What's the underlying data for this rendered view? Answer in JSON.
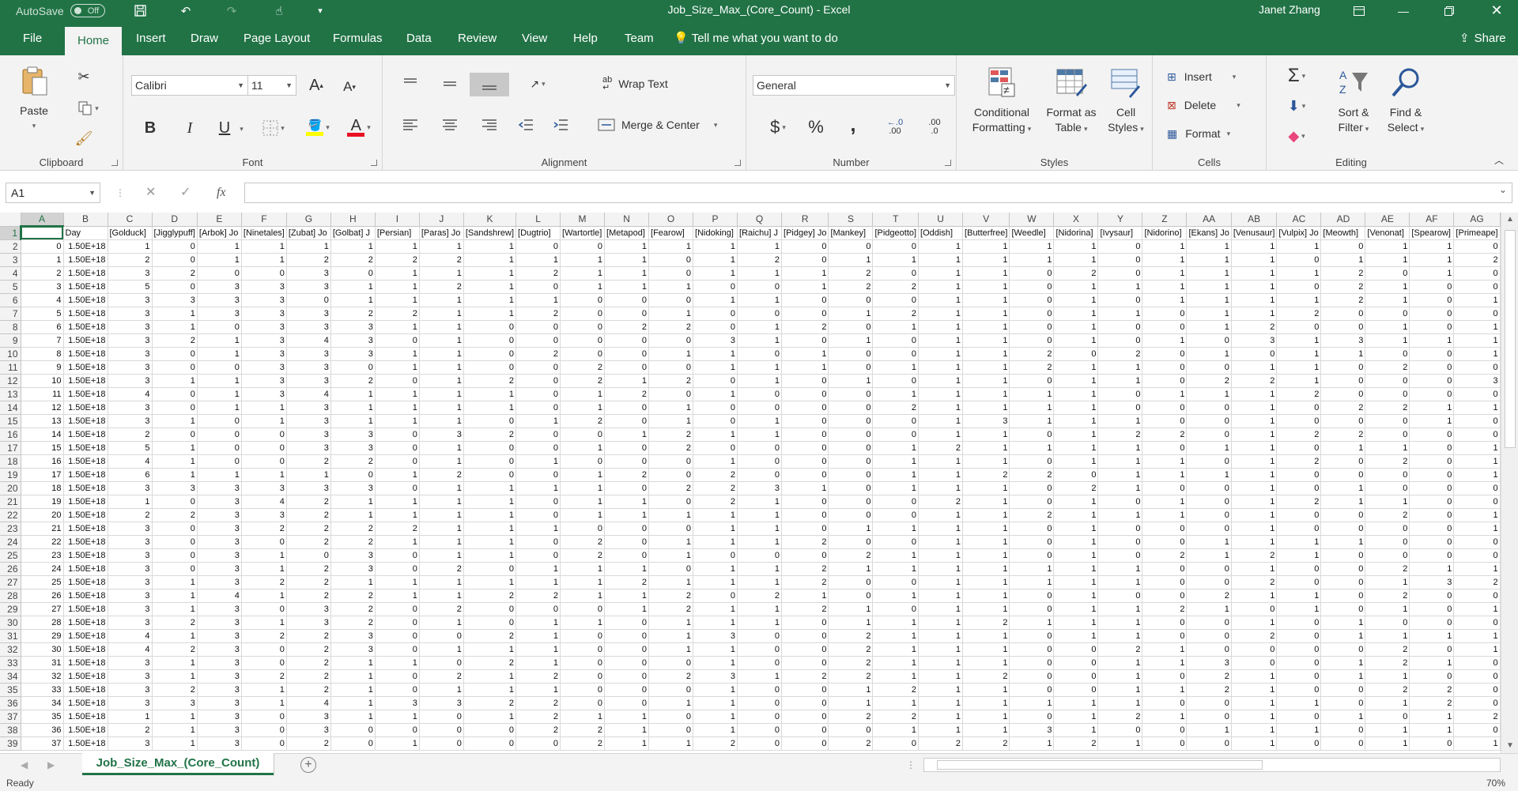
{
  "app": {
    "title": "Job_Size_Max_(Core_Count)  -  Excel",
    "autosave_label": "AutoSave",
    "autosave_state": "Off",
    "user": "Janet Zhang",
    "accent": "#217346"
  },
  "tabs": [
    "File",
    "Home",
    "Insert",
    "Draw",
    "Page Layout",
    "Formulas",
    "Data",
    "Review",
    "View",
    "Help",
    "Team"
  ],
  "tell_me": "Tell me what you want to do",
  "share": "Share",
  "ribbon": {
    "clipboard": {
      "label": "Clipboard",
      "paste": "Paste"
    },
    "font": {
      "label": "Font",
      "name": "Calibri",
      "size": "11",
      "bold": "B",
      "italic": "I",
      "underline": "U"
    },
    "alignment": {
      "label": "Alignment",
      "wrap": "Wrap Text",
      "merge": "Merge & Center"
    },
    "number": {
      "label": "Number",
      "format": "General",
      "currency": "$",
      "percent": "%",
      "comma": ",",
      "inc_decimal": ".00",
      "dec_decimal": ".0"
    },
    "styles": {
      "label": "Styles",
      "conditional": [
        "Conditional",
        "Formatting"
      ],
      "format_table": [
        "Format as",
        "Table"
      ],
      "cell_styles": [
        "Cell",
        "Styles"
      ]
    },
    "cells": {
      "label": "Cells",
      "insert": "Insert",
      "delete": "Delete",
      "format": "Format"
    },
    "editing": {
      "label": "Editing",
      "sort": [
        "Sort &",
        "Filter"
      ],
      "find": [
        "Find &",
        "Select"
      ]
    }
  },
  "formula_bar": {
    "name_box": "A1",
    "fx": "fx",
    "content": ""
  },
  "grid": {
    "columns": [
      "A",
      "B",
      "C",
      "D",
      "E",
      "F",
      "G",
      "H",
      "I",
      "J",
      "K",
      "L",
      "M",
      "N",
      "O",
      "P",
      "Q",
      "R",
      "S",
      "T",
      "U",
      "V",
      "W",
      "X",
      "Y",
      "Z",
      "AA",
      "AB",
      "AC",
      "AD",
      "AE",
      "AF",
      "AG"
    ],
    "header_row": [
      "",
      "Day",
      "[Golduck]",
      "[Jigglypuff]",
      "[Arbok] Jo",
      "[Ninetales]",
      "[Zubat] Jo",
      "[Golbat] J",
      "[Persian]",
      "[Paras] Jo",
      "[Sandshrew]",
      "[Dugtrio]",
      "[Wartortle]",
      "[Metapod]",
      "[Fearow]",
      "[Nidoking]",
      "[Raichu] J",
      "[Pidgey] Jo",
      "[Mankey]",
      "[Pidgeotto]",
      "[Oddish]",
      "[Butterfree]",
      "[Weedle]",
      "[Nidorina]",
      "[Ivysaur]",
      "[Nidorino]",
      "[Ekans] Jo",
      "[Venusaur]",
      "[Vulpix] Jo",
      "[Meowth]",
      "[Venonat]",
      "[Spearow]",
      "[Primeape]"
    ],
    "day_value": "1.50E+18",
    "rows": [
      [
        0,
        1,
        0,
        1,
        1,
        1,
        1,
        1,
        1,
        1,
        0,
        0,
        1,
        1,
        1,
        1,
        0,
        0,
        0,
        1,
        1,
        1,
        1,
        0,
        1,
        1,
        1,
        1,
        0,
        1,
        1,
        0
      ],
      [
        1,
        2,
        0,
        1,
        1,
        2,
        2,
        2,
        2,
        1,
        1,
        1,
        1,
        0,
        1,
        2,
        0,
        1,
        1,
        1,
        1,
        1,
        1,
        0,
        1,
        1,
        1,
        0,
        1,
        1,
        1,
        2
      ],
      [
        2,
        3,
        2,
        0,
        0,
        3,
        0,
        1,
        1,
        1,
        2,
        1,
        1,
        0,
        1,
        1,
        1,
        2,
        0,
        1,
        1,
        0,
        2,
        0,
        1,
        1,
        1,
        1,
        2,
        0,
        1,
        0
      ],
      [
        3,
        5,
        0,
        3,
        3,
        3,
        1,
        1,
        2,
        1,
        0,
        1,
        1,
        1,
        0,
        0,
        1,
        2,
        2,
        1,
        1,
        0,
        1,
        1,
        1,
        1,
        1,
        0,
        2,
        1,
        0,
        0
      ],
      [
        4,
        3,
        3,
        3,
        3,
        0,
        1,
        1,
        1,
        1,
        1,
        0,
        0,
        0,
        1,
        1,
        0,
        0,
        0,
        1,
        1,
        0,
        1,
        0,
        1,
        1,
        1,
        1,
        2,
        1,
        0,
        1
      ],
      [
        5,
        3,
        1,
        3,
        3,
        3,
        2,
        2,
        1,
        1,
        2,
        0,
        0,
        1,
        0,
        0,
        0,
        1,
        2,
        1,
        1,
        0,
        1,
        1,
        0,
        1,
        1,
        2,
        0,
        0,
        0,
        0
      ],
      [
        6,
        3,
        1,
        0,
        3,
        3,
        3,
        1,
        1,
        0,
        0,
        0,
        2,
        2,
        0,
        1,
        2,
        0,
        1,
        1,
        1,
        0,
        1,
        0,
        0,
        1,
        2,
        0,
        0,
        1,
        0,
        1
      ],
      [
        7,
        3,
        2,
        1,
        3,
        4,
        3,
        0,
        1,
        0,
        0,
        0,
        0,
        0,
        3,
        1,
        0,
        1,
        0,
        1,
        1,
        0,
        1,
        0,
        1,
        0,
        3,
        1,
        3,
        1,
        1,
        1
      ],
      [
        8,
        3,
        0,
        1,
        3,
        3,
        3,
        1,
        1,
        0,
        2,
        0,
        0,
        1,
        1,
        0,
        1,
        0,
        0,
        1,
        1,
        2,
        0,
        2,
        0,
        1,
        0,
        1,
        1,
        0,
        0,
        1
      ],
      [
        9,
        3,
        0,
        0,
        3,
        3,
        0,
        1,
        1,
        0,
        0,
        2,
        0,
        0,
        1,
        1,
        1,
        0,
        1,
        1,
        1,
        2,
        1,
        1,
        0,
        0,
        1,
        1,
        0,
        2,
        0,
        0
      ],
      [
        10,
        3,
        1,
        1,
        3,
        3,
        2,
        0,
        1,
        2,
        0,
        2,
        1,
        2,
        0,
        1,
        0,
        1,
        0,
        1,
        1,
        0,
        1,
        1,
        0,
        2,
        2,
        1,
        0,
        0,
        0,
        3
      ],
      [
        11,
        4,
        0,
        1,
        3,
        4,
        1,
        1,
        1,
        1,
        0,
        1,
        2,
        0,
        1,
        0,
        0,
        0,
        1,
        1,
        1,
        1,
        1,
        0,
        1,
        1,
        1,
        2,
        0,
        0,
        0,
        0
      ],
      [
        12,
        3,
        0,
        1,
        1,
        3,
        1,
        1,
        1,
        1,
        0,
        1,
        0,
        1,
        0,
        0,
        0,
        0,
        2,
        1,
        1,
        1,
        1,
        0,
        0,
        0,
        1,
        0,
        2,
        2,
        1,
        1
      ],
      [
        13,
        3,
        1,
        0,
        1,
        3,
        1,
        1,
        1,
        0,
        1,
        2,
        0,
        1,
        0,
        1,
        0,
        0,
        0,
        1,
        3,
        1,
        1,
        1,
        0,
        0,
        1,
        0,
        0,
        0,
        1,
        0
      ],
      [
        14,
        2,
        0,
        0,
        0,
        3,
        3,
        0,
        3,
        2,
        0,
        0,
        1,
        2,
        1,
        1,
        0,
        0,
        0,
        1,
        1,
        0,
        1,
        2,
        2,
        0,
        1,
        2,
        2,
        0,
        0,
        0
      ],
      [
        15,
        5,
        1,
        0,
        0,
        3,
        3,
        0,
        1,
        0,
        0,
        1,
        0,
        2,
        0,
        0,
        0,
        0,
        1,
        2,
        1,
        1,
        1,
        1,
        0,
        1,
        1,
        0,
        1,
        1,
        0,
        1
      ],
      [
        16,
        4,
        1,
        0,
        0,
        2,
        2,
        0,
        1,
        0,
        1,
        0,
        0,
        0,
        1,
        0,
        0,
        0,
        1,
        1,
        1,
        0,
        1,
        1,
        1,
        0,
        1,
        2,
        0,
        2,
        0,
        1
      ],
      [
        17,
        6,
        1,
        1,
        1,
        1,
        0,
        1,
        2,
        0,
        0,
        1,
        2,
        0,
        2,
        0,
        0,
        0,
        1,
        1,
        2,
        2,
        0,
        1,
        1,
        1,
        1,
        0,
        0,
        0,
        0,
        1
      ],
      [
        18,
        3,
        3,
        3,
        3,
        3,
        3,
        0,
        1,
        1,
        1,
        1,
        0,
        2,
        2,
        3,
        1,
        0,
        1,
        1,
        1,
        0,
        2,
        1,
        0,
        0,
        1,
        0,
        1,
        0,
        0,
        0
      ],
      [
        19,
        1,
        0,
        3,
        4,
        2,
        1,
        1,
        1,
        1,
        0,
        1,
        1,
        0,
        2,
        1,
        0,
        0,
        0,
        2,
        1,
        0,
        1,
        0,
        1,
        0,
        1,
        2,
        1,
        1,
        0,
        0
      ],
      [
        20,
        2,
        2,
        3,
        3,
        2,
        1,
        1,
        1,
        1,
        0,
        1,
        1,
        1,
        1,
        1,
        0,
        0,
        0,
        1,
        1,
        2,
        1,
        1,
        1,
        0,
        1,
        0,
        0,
        2,
        0,
        1
      ],
      [
        21,
        3,
        0,
        3,
        2,
        2,
        2,
        2,
        1,
        1,
        1,
        0,
        0,
        0,
        1,
        1,
        0,
        1,
        1,
        1,
        1,
        0,
        1,
        0,
        0,
        0,
        1,
        0,
        0,
        0,
        0,
        1
      ],
      [
        22,
        3,
        0,
        3,
        0,
        2,
        2,
        1,
        1,
        1,
        0,
        2,
        0,
        1,
        1,
        1,
        2,
        0,
        0,
        1,
        1,
        0,
        1,
        0,
        0,
        1,
        1,
        1,
        1,
        0,
        0,
        0
      ],
      [
        23,
        3,
        0,
        3,
        1,
        0,
        3,
        0,
        1,
        1,
        0,
        2,
        0,
        1,
        0,
        0,
        0,
        2,
        1,
        1,
        1,
        0,
        1,
        0,
        2,
        1,
        2,
        1,
        0,
        0,
        0,
        0
      ],
      [
        24,
        3,
        0,
        3,
        1,
        2,
        3,
        0,
        2,
        0,
        1,
        1,
        1,
        0,
        1,
        1,
        2,
        1,
        1,
        1,
        1,
        1,
        1,
        1,
        0,
        0,
        1,
        0,
        0,
        2,
        1,
        1
      ],
      [
        25,
        3,
        1,
        3,
        2,
        2,
        1,
        1,
        1,
        1,
        1,
        1,
        2,
        1,
        1,
        1,
        2,
        0,
        0,
        1,
        1,
        1,
        1,
        1,
        0,
        0,
        2,
        0,
        0,
        1,
        3,
        2
      ],
      [
        26,
        3,
        1,
        4,
        1,
        2,
        2,
        1,
        1,
        2,
        2,
        1,
        1,
        2,
        0,
        2,
        1,
        0,
        1,
        1,
        1,
        0,
        1,
        0,
        0,
        2,
        1,
        1,
        0,
        2,
        0,
        0
      ],
      [
        27,
        3,
        1,
        3,
        0,
        3,
        2,
        0,
        2,
        0,
        0,
        0,
        1,
        2,
        1,
        1,
        2,
        1,
        0,
        1,
        1,
        0,
        1,
        1,
        2,
        1,
        0,
        1,
        0,
        1,
        0,
        1
      ],
      [
        28,
        3,
        2,
        3,
        1,
        3,
        2,
        0,
        1,
        0,
        1,
        1,
        0,
        1,
        1,
        1,
        0,
        1,
        1,
        1,
        2,
        1,
        1,
        1,
        0,
        0,
        1,
        0,
        1,
        0,
        0,
        0
      ],
      [
        29,
        4,
        1,
        3,
        2,
        2,
        3,
        0,
        0,
        2,
        1,
        0,
        0,
        1,
        3,
        0,
        0,
        2,
        1,
        1,
        1,
        0,
        1,
        1,
        0,
        0,
        2,
        0,
        1,
        1,
        1,
        1
      ],
      [
        30,
        4,
        2,
        3,
        0,
        2,
        3,
        0,
        1,
        1,
        1,
        0,
        0,
        1,
        1,
        0,
        0,
        2,
        1,
        1,
        1,
        0,
        0,
        2,
        1,
        0,
        0,
        0,
        0,
        2,
        0,
        1
      ],
      [
        31,
        3,
        1,
        3,
        0,
        2,
        1,
        1,
        0,
        2,
        1,
        0,
        0,
        0,
        1,
        0,
        0,
        2,
        1,
        1,
        1,
        0,
        0,
        1,
        1,
        3,
        0,
        0,
        1,
        2,
        1,
        0
      ],
      [
        32,
        3,
        1,
        3,
        2,
        2,
        1,
        0,
        2,
        1,
        2,
        0,
        0,
        2,
        3,
        1,
        2,
        2,
        1,
        1,
        2,
        0,
        0,
        1,
        0,
        2,
        1,
        0,
        1,
        1,
        0,
        0
      ],
      [
        33,
        3,
        2,
        3,
        1,
        2,
        1,
        0,
        1,
        1,
        1,
        0,
        0,
        0,
        1,
        0,
        0,
        1,
        2,
        1,
        1,
        0,
        0,
        1,
        1,
        2,
        1,
        0,
        0,
        2,
        2,
        0
      ],
      [
        34,
        3,
        3,
        3,
        1,
        4,
        1,
        3,
        3,
        2,
        2,
        0,
        0,
        1,
        1,
        0,
        0,
        1,
        1,
        1,
        1,
        1,
        1,
        1,
        0,
        0,
        1,
        1,
        0,
        1,
        2,
        0
      ],
      [
        35,
        1,
        1,
        3,
        0,
        3,
        1,
        1,
        0,
        1,
        2,
        1,
        1,
        0,
        1,
        0,
        0,
        2,
        2,
        1,
        1,
        0,
        1,
        2,
        1,
        0,
        1,
        0,
        1,
        0,
        1,
        2
      ],
      [
        36,
        2,
        1,
        3,
        0,
        3,
        0,
        0,
        0,
        0,
        2,
        2,
        1,
        0,
        1,
        0,
        0,
        0,
        1,
        1,
        1,
        3,
        1,
        0,
        0,
        1,
        1,
        1,
        0,
        1,
        1,
        0
      ],
      [
        37,
        3,
        1,
        3,
        0,
        2,
        0,
        1,
        0,
        0,
        0,
        2,
        1,
        1,
        2,
        0,
        0,
        2,
        0,
        2,
        2,
        1,
        2,
        1,
        0,
        0,
        1,
        0,
        0,
        1,
        0,
        1
      ]
    ]
  },
  "sheet_tab": "Job_Size_Max_(Core_Count)",
  "status": {
    "ready": "Ready",
    "zoom": "70%"
  }
}
